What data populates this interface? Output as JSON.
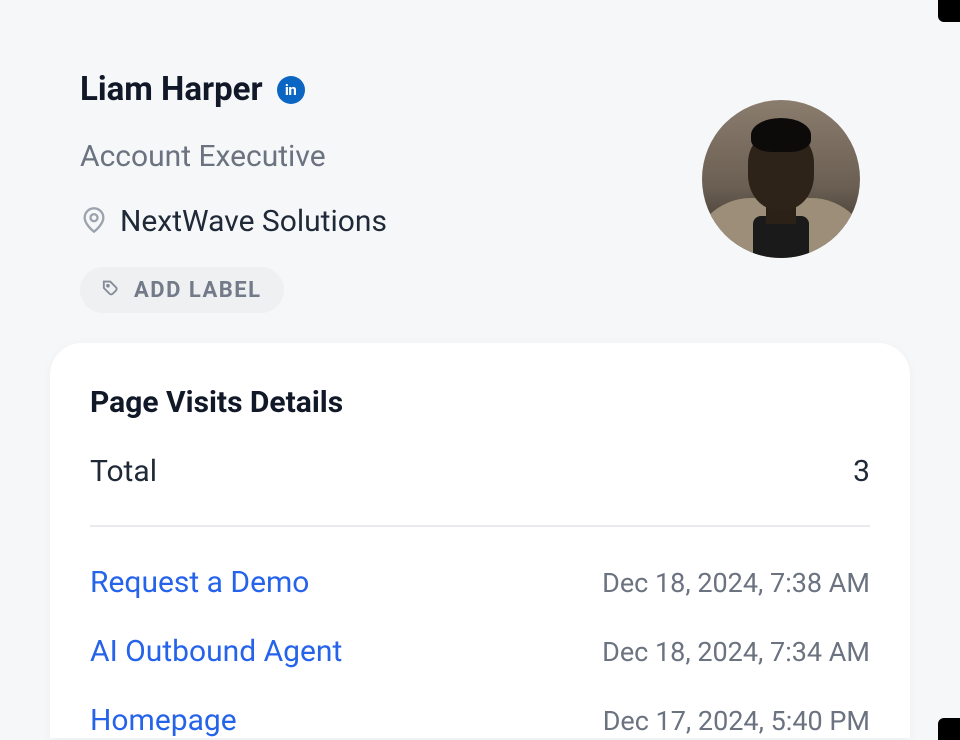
{
  "profile": {
    "name": "Liam Harper",
    "title": "Account Executive",
    "company": "NextWave Solutions",
    "add_label_text": "ADD LABEL"
  },
  "page_visits": {
    "heading": "Page Visits Details",
    "total_label": "Total",
    "total_count": "3",
    "visits": [
      {
        "page": "Request a Demo",
        "timestamp": "Dec 18, 2024, 7:38 AM"
      },
      {
        "page": "AI Outbound Agent",
        "timestamp": "Dec 18, 2024, 7:34 AM"
      },
      {
        "page": "Homepage",
        "timestamp": "Dec 17, 2024, 5:40 PM"
      }
    ]
  }
}
